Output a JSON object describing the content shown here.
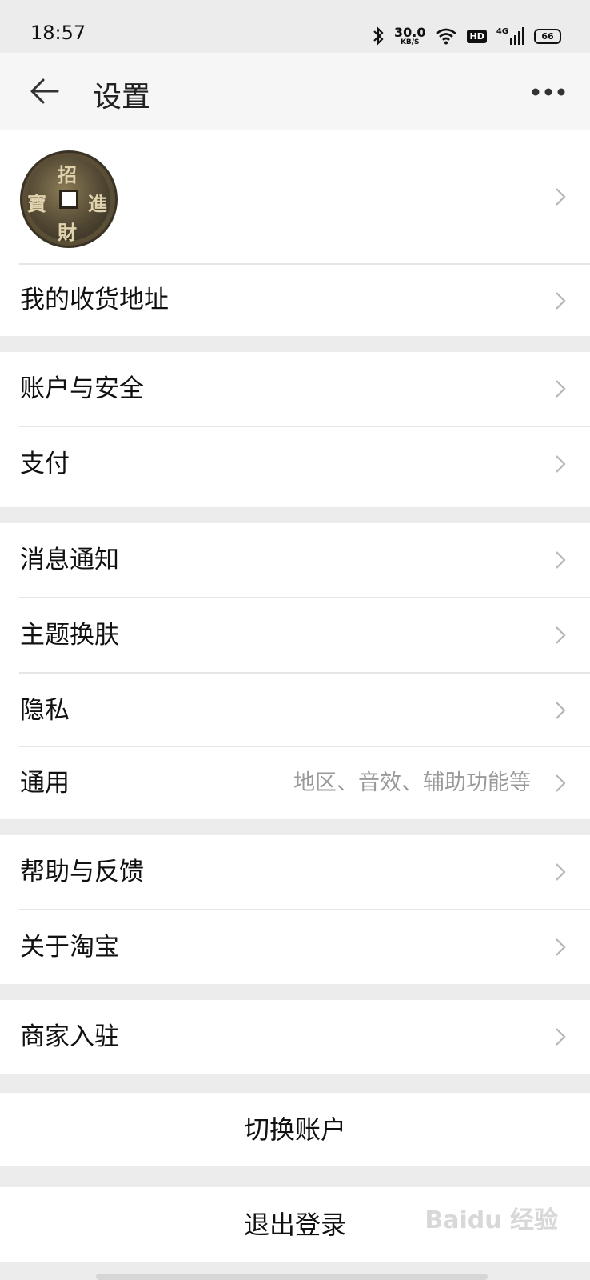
{
  "status_bar": {
    "time": "18:57",
    "net_speed_value": "30.0",
    "net_speed_unit": "KB/S",
    "hd_label": "HD",
    "network": "4G",
    "battery": "66"
  },
  "header": {
    "title": "设置"
  },
  "rows": {
    "address": "我的收货地址",
    "account_security": "账户与安全",
    "payment": "支付",
    "notifications": "消息通知",
    "theme": "主题换肤",
    "privacy": "隐私",
    "general": "通用",
    "general_hint": "地区、音效、辅助功能等",
    "help_feedback": "帮助与反馈",
    "about": "关于淘宝",
    "merchant": "商家入驻"
  },
  "actions": {
    "switch_account": "切换账户",
    "logout": "退出登录"
  },
  "avatar_chars": {
    "top": "招",
    "left": "寶",
    "right": "進",
    "bottom": "財"
  },
  "watermark": "Baidu 经验",
  "colors": {
    "background": "#ececec",
    "card": "#ffffff",
    "divider": "#e6e6e6",
    "hint_text": "#9a9a9a",
    "chevron": "#b5b5b5"
  }
}
